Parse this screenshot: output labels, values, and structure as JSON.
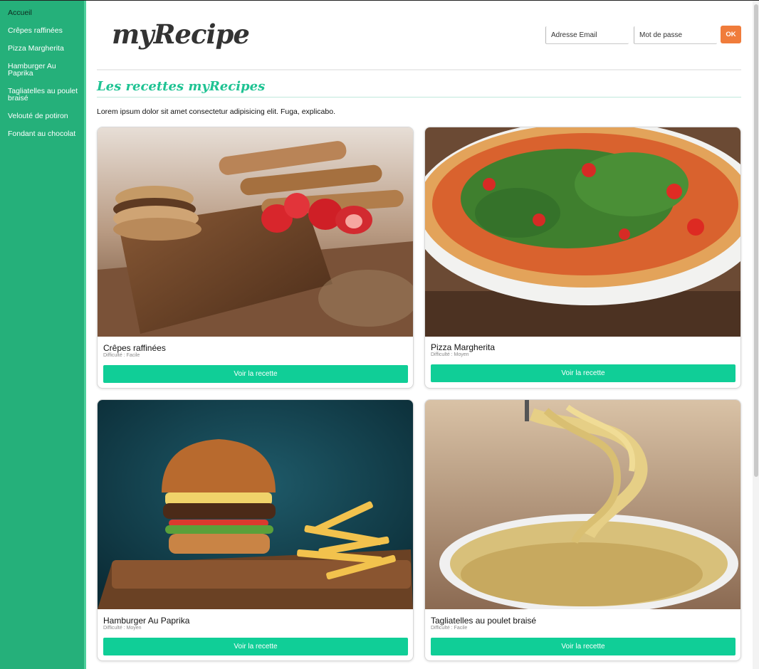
{
  "sidebar": {
    "items": [
      {
        "label": "Accueil",
        "active": true
      },
      {
        "label": "Crêpes raffinées"
      },
      {
        "label": "Pizza Margherita"
      },
      {
        "label": "Hamburger Au Paprika"
      },
      {
        "label": "Tagliatelles au poulet braisé"
      },
      {
        "label": "Velouté de potiron"
      },
      {
        "label": "Fondant au chocolat"
      }
    ]
  },
  "header": {
    "logo": "myRecipe",
    "email_placeholder": "Adresse Email",
    "password_placeholder": "Mot de passe",
    "ok_label": "OK"
  },
  "main": {
    "title": "Les recettes myRecipes",
    "intro": "Lorem ipsum dolor sit amet consectetur adipisicing elit. Fuga, explicabo.",
    "cards": [
      {
        "name": "Crêpes raffinées",
        "difficulty": "Difficulté : Facile",
        "button": "Voir la recette",
        "image": "crepes-photo"
      },
      {
        "name": "Pizza Margherita",
        "difficulty": "Difficulté : Moyen",
        "button": "Voir la recette",
        "image": "pizza-photo"
      },
      {
        "name": "Hamburger Au Paprika",
        "difficulty": "Difficulté : Moyen",
        "button": "Voir la recette",
        "image": "burger-photo"
      },
      {
        "name": "Tagliatelles au poulet braisé",
        "difficulty": "Difficulté : Facile",
        "button": "Voir la recette",
        "image": "pasta-photo"
      }
    ]
  },
  "colors": {
    "sidebar": "#25b07a",
    "accent": "#10ce97",
    "title": "#1fc393",
    "ok_button": "#f07c3b"
  }
}
